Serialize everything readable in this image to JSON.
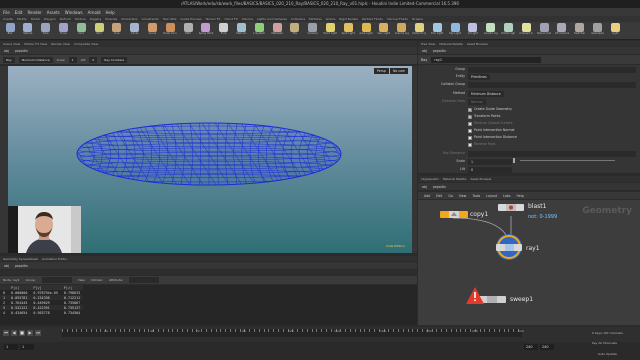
{
  "window": {
    "title": "/ATLAS/Work/edu/sb/work_files/BASICS/BASICS_020_210_Ray/BASICS_020_210_Ray_v01.hiplc - Houdini Indie Limited-Commercial 16.5.396"
  },
  "menubar": [
    "File",
    "Edit",
    "Render",
    "Assets",
    "Windows",
    "Arnold",
    "Help"
  ],
  "shelf_tabs": [
    "Create",
    "Modify",
    "Model",
    "Polygon",
    "Deform",
    "Texture",
    "Rigging",
    "Muscles",
    "Characters",
    "Constraints",
    "Hair Utils",
    "Guide Process",
    "Terrain FX",
    "Cloud FX",
    "Volume",
    "Lights and Cameras",
    "Collisions",
    "Particles",
    "Grains",
    "Rigid Bodies",
    "Particle Fluids",
    "Viscous Fluids",
    "Oceans"
  ],
  "shelf_tools": [
    {
      "label": "Box",
      "color": "#8fa3c7"
    },
    {
      "label": "Sphere",
      "color": "#9db0d0"
    },
    {
      "label": "Tube",
      "color": "#9aa6bd"
    },
    {
      "label": "Torus",
      "color": "#a3a0c9"
    },
    {
      "label": "Grid",
      "color": "#8fbf9a"
    },
    {
      "label": "Null",
      "color": "#cfcf7a"
    },
    {
      "label": "Line",
      "color": "#c8a37a"
    },
    {
      "label": "Circle",
      "color": "#a5b4cf"
    },
    {
      "label": "Curve",
      "color": "#d49a6a"
    },
    {
      "label": "Draw Curve",
      "color": "#cc8f5a"
    },
    {
      "label": "Path",
      "color": "#b0b0b0"
    },
    {
      "label": "Spray Paint",
      "color": "#c29cd0"
    },
    {
      "label": "Font",
      "color": "#d0d0d0"
    },
    {
      "label": "Platonic",
      "color": "#a0c0d0"
    },
    {
      "label": "L-System",
      "color": "#8ed07a"
    },
    {
      "label": "Metaball",
      "color": "#d0a0a0"
    },
    {
      "label": "File",
      "color": "#c0b080"
    },
    {
      "label": "Camera",
      "color": "#9aa0a8"
    },
    {
      "label": "Point Light",
      "color": "#e0d070"
    },
    {
      "label": "Spot Light",
      "color": "#e0c060"
    },
    {
      "label": "Area Light",
      "color": "#e0b850"
    },
    {
      "label": "Geo Light",
      "color": "#d8b060"
    },
    {
      "label": "Volume Light",
      "color": "#d0a860"
    },
    {
      "label": "Distant Light",
      "color": "#e0d080"
    },
    {
      "label": "Env Light",
      "color": "#a0c8e0"
    },
    {
      "label": "Sky Light",
      "color": "#90b8e0"
    },
    {
      "label": "GI Light",
      "color": "#c0c0e0"
    },
    {
      "label": "Caustic Light",
      "color": "#c0e0c0"
    },
    {
      "label": "Portal Light",
      "color": "#b0d0c0"
    },
    {
      "label": "Ambient Light",
      "color": "#e0e0a0"
    },
    {
      "label": "Stereo Camera",
      "color": "#a0a0b0"
    },
    {
      "label": "VR Camera",
      "color": "#a8a8b8"
    },
    {
      "label": "Switcher",
      "color": "#b0a8a0"
    },
    {
      "label": "Gamepad",
      "color": "#a0a0a0"
    },
    {
      "label": "Light",
      "color": "#e8d080"
    }
  ],
  "left_pane": {
    "tabs": [
      "Scene View",
      "Motion FX View",
      "Render View",
      "Composite View"
    ],
    "path": [
      "obj",
      "pepaitin"
    ],
    "toolbar": {
      "node_type": "Ray",
      "method": "Minimum Distance",
      "scale_label": "Scale",
      "scale_value": "1",
      "lift_label": "Lift",
      "lift_value": "0",
      "collide_label": "Ray Combine"
    },
    "viewport": {
      "cam_label": "Persp",
      "display_label": "No cam",
      "footer": "Indie Edition"
    }
  },
  "spreadsheet": {
    "tabs": [
      "Geometry Spreadsheet",
      "Animation Editor"
    ],
    "path": [
      "obj",
      "pepaitin"
    ],
    "toolbar": [
      "Node: ray1",
      "Group:",
      "View",
      "Intrinsic",
      "Attribute:"
    ],
    "columns": [
      "",
      "P[x]",
      "P[y]",
      "P[z]"
    ],
    "rows": [
      [
        "0",
        "0.000000",
        "0.978794e-05",
        "0.798633"
      ],
      [
        "1",
        "0.055781",
        "0.234336",
        "0.712211"
      ],
      [
        "2",
        "0.764445",
        "0.449629",
        "0.735867"
      ],
      [
        "3",
        "0.532122",
        "0.422391",
        "0.735137"
      ],
      [
        "4",
        "0.434654",
        "0.563778",
        "0.734564"
      ]
    ]
  },
  "timeline": {
    "controls": [
      "⏮",
      "◀",
      "■",
      "▶",
      "⏭"
    ],
    "ticks": [
      "24",
      "48",
      "72",
      "96",
      "120",
      "144",
      "168",
      "192",
      "216",
      "240"
    ],
    "start_frame": "1",
    "current_frame": "1",
    "end_frame": "240",
    "end_frame2": "240",
    "keys_label": "0 keys, 0/0 channels",
    "key_all_label": "Key All Channels",
    "auto_update": "Auto Update"
  },
  "param_pane": {
    "tabs": [
      "Tree View",
      "Material Palette",
      "Asset Browser"
    ],
    "path": [
      "obj",
      "pepaitin"
    ],
    "node_type": "Ray",
    "node_name": "ray1",
    "params": {
      "group_label": "Group",
      "entity_label": "Entity",
      "entity_value": "Primitives",
      "collision_group_label": "Collision Group",
      "method_label": "Method",
      "method_value": "Minimum Distance",
      "direction_label": "Direction from",
      "direction_value": "Normal",
      "cb_vertical": "Create Guide Geometry",
      "cb_transform": "Transform Points",
      "cb_reverse": "Reverse Closest Surface",
      "cb_intersect": "Point Intersection Normal",
      "cb_intersect_dist": "Point Intersection Distance",
      "cb_reverse_rays": "Reverse Rays",
      "max_tol_label": "Ray Tolerance",
      "scale_label": "Scale",
      "scale_value": "1",
      "lift_label": "Lift",
      "lift_value": "0"
    }
  },
  "network": {
    "tabs": [
      "obj/pepaitin",
      "Material Palette",
      "Asset Browser"
    ],
    "path": [
      "obj",
      "pepaitin"
    ],
    "menu": [
      "Add",
      "Edit",
      "Go",
      "View",
      "Tools",
      "Layout",
      "Labs",
      "Help"
    ],
    "context_label": "Geometry",
    "nodes": {
      "copy1": "copy1",
      "blast1": "blast1",
      "blast1_note": "not: 0-1999",
      "ray1": "ray1",
      "sweep1": "sweep1"
    }
  },
  "colors": {
    "wireframe": "#1d2bd8",
    "viewport_top": "#9bb0c2",
    "viewport_bottom": "#2f6f74",
    "node_highlight": "#f2a81d"
  }
}
